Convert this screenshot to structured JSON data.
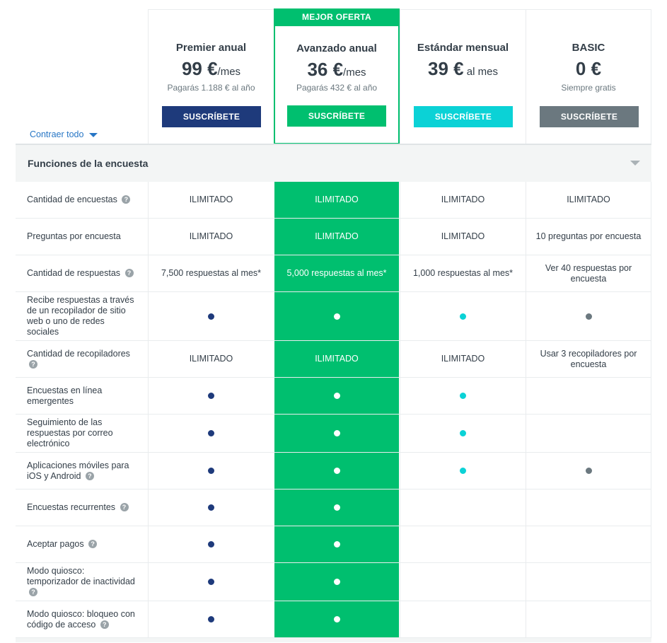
{
  "controls": {
    "collapse_all": "Contraer todo"
  },
  "featured_badge": "MEJOR OFERTA",
  "plans": [
    {
      "name": "Premier anual",
      "price": "99 €",
      "period": "/mes",
      "note": "Pagarás 1.188 € al año",
      "button": "SUSCRÍBETE",
      "color": "#1e3a7b"
    },
    {
      "name": "Avanzado anual",
      "price": "36 €",
      "period": "/mes",
      "note": "Pagarás 432 € al año",
      "button": "SUSCRÍBETE",
      "color": "#00bf6f"
    },
    {
      "name": "Estándar mensual",
      "price": "39 €",
      "period": " al mes",
      "note": "",
      "button": "SUSCRÍBETE",
      "color": "#0bd2d6"
    },
    {
      "name": "BASIC",
      "price": "0 €",
      "period": "",
      "note": "Siempre gratis",
      "button": "SUSCRÍBETE",
      "color": "#6b787f"
    }
  ],
  "section": {
    "title": "Funciones de la encuesta"
  },
  "features": [
    {
      "label": "Cantidad de encuestas",
      "help": true,
      "values": [
        "ILIMITADO",
        "ILIMITADO",
        "ILIMITADO",
        "ILIMITADO"
      ]
    },
    {
      "label": "Preguntas por encuesta",
      "help": false,
      "values": [
        "ILIMITADO",
        "ILIMITADO",
        "ILIMITADO",
        "10 preguntas por encuesta"
      ]
    },
    {
      "label": "Cantidad de respuestas",
      "help": true,
      "values": [
        "7,500 respuestas al mes*",
        "5,000 respuestas al mes*",
        "1,000 respuestas al mes*",
        "Ver 40 respuestas por encuesta"
      ]
    },
    {
      "label": "Recibe respuestas a través de un recopilador de sitio web o uno de redes sociales",
      "help": false,
      "values": [
        "•",
        "•",
        "•",
        "•"
      ]
    },
    {
      "label": "Cantidad de recopiladores",
      "help": true,
      "values": [
        "ILIMITADO",
        "ILIMITADO",
        "ILIMITADO",
        "Usar 3 recopiladores por encuesta"
      ]
    },
    {
      "label": "Encuestas en línea emergentes",
      "help": false,
      "values": [
        "•",
        "•",
        "•",
        ""
      ]
    },
    {
      "label": "Seguimiento de las respuestas por correo electrónico",
      "help": false,
      "values": [
        "•",
        "•",
        "•",
        ""
      ]
    },
    {
      "label": "Aplicaciones móviles para iOS y Android",
      "help": true,
      "values": [
        "•",
        "•",
        "•",
        "•"
      ]
    },
    {
      "label": "Encuestas recurrentes",
      "help": true,
      "values": [
        "•",
        "•",
        "",
        ""
      ]
    },
    {
      "label": "Aceptar pagos",
      "help": true,
      "values": [
        "•",
        "•",
        "",
        ""
      ]
    },
    {
      "label": "Modo quiosco: temporizador de inactividad",
      "help": true,
      "values": [
        "•",
        "•",
        "",
        ""
      ]
    },
    {
      "label": "Modo quiosco: bloqueo con código de acceso",
      "help": true,
      "values": [
        "•",
        "•",
        "",
        ""
      ]
    }
  ],
  "colors": {
    "accent_green": "#00bf6f",
    "navy": "#1e3a7b",
    "teal": "#0bd2d6",
    "gray": "#6b787f",
    "link_blue": "#2776c5",
    "dot_white": "#ffffff"
  },
  "icons": {
    "help": "question-circle-icon",
    "included": "filled-dot-icon",
    "collapse": "caret-down-icon"
  }
}
